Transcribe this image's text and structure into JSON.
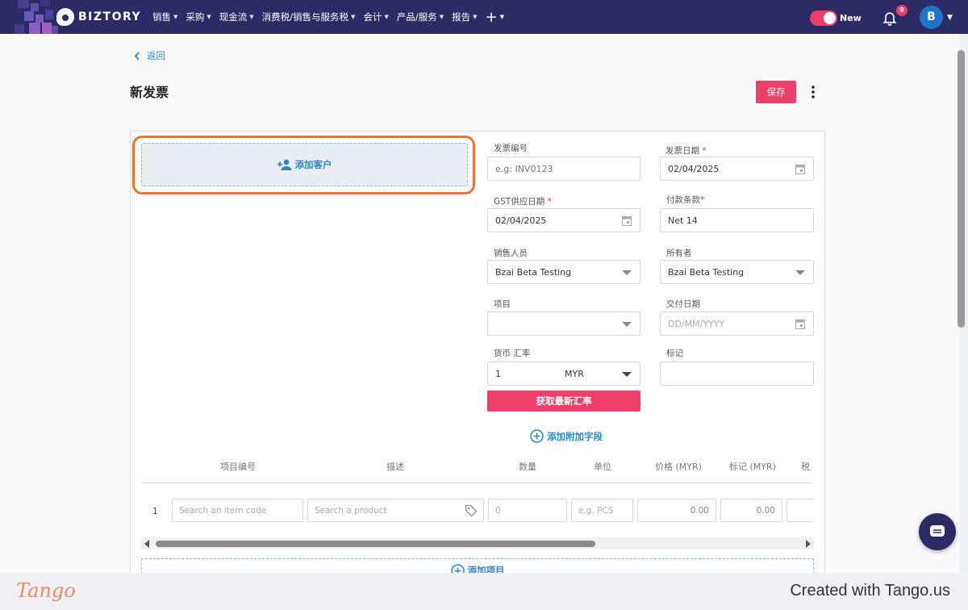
{
  "topbar": {
    "brand": "BIZTORY",
    "nav": [
      {
        "label": "销售"
      },
      {
        "label": "采购"
      },
      {
        "label": "现金流"
      },
      {
        "label": "消费税/销售与服务税"
      },
      {
        "label": "会计"
      },
      {
        "label": "产品/服务"
      },
      {
        "label": "报告"
      }
    ],
    "toggle_label": "New",
    "notification_count": "9",
    "avatar_initial": "B"
  },
  "page": {
    "back_label": "返回",
    "title": "新发票",
    "save_label": "保存"
  },
  "customer": {
    "add_label": "添加客户"
  },
  "form": {
    "invoice_no": {
      "label": "发票编号",
      "placeholder": "e.g: INV0123"
    },
    "invoice_date": {
      "label": "发票日期",
      "value": "02/04/2025"
    },
    "gst_date": {
      "label": "GST供应日期",
      "value": "02/04/2025"
    },
    "payment_terms": {
      "label": "付款条款",
      "value": "Net 14"
    },
    "salesperson": {
      "label": "销售人员",
      "value": "Bzai Beta Testing"
    },
    "owner": {
      "label": "所有者",
      "value": "Bzai Beta Testing"
    },
    "project": {
      "label": "项目",
      "value": ""
    },
    "delivery_date": {
      "label": "交付日期",
      "placeholder": "DD/MM/YYYY"
    },
    "currency": {
      "label": "货币 汇率",
      "rate": "1",
      "code": "MYR"
    },
    "tag": {
      "label": "标记",
      "value": ""
    },
    "rate_button": "获取最新汇率",
    "add_field": "添加附加字段"
  },
  "items_table": {
    "headers": [
      "项目编号",
      "描述",
      "数量",
      "单位",
      "价格 (MYR)",
      "标记 (MYR)",
      "税"
    ],
    "rows": [
      {
        "num": "1",
        "code_placeholder": "Search an item code",
        "product_placeholder": "Search a product",
        "qty_placeholder": "0",
        "unit_placeholder": "e.g. PCS",
        "price": "0.00",
        "tag_amount": "0.00"
      }
    ],
    "add_item": "添加项目"
  },
  "footer": {
    "logo": "Tango",
    "created": "Created with Tango.us"
  },
  "colors": {
    "navbar": "#2d2b66",
    "accent": "#ee3f6b",
    "link": "#2a87c6",
    "highlight": "#f07232"
  }
}
